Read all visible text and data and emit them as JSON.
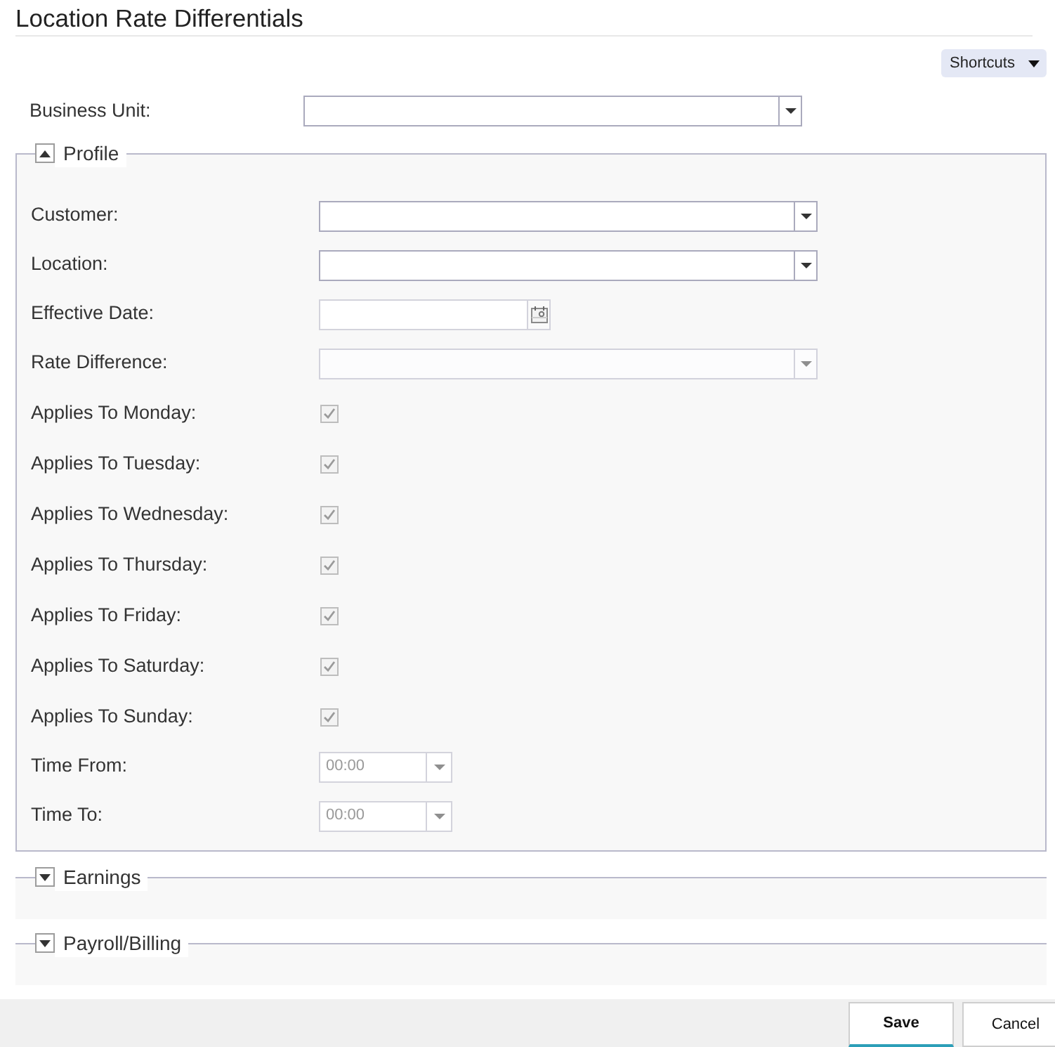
{
  "page": {
    "title": "Location Rate Differentials"
  },
  "toolbar": {
    "shortcuts_button": "Shortcuts"
  },
  "top_fields": [
    {
      "kind": "dropdown",
      "label": "Business Unit:",
      "disabled": false
    }
  ],
  "sections": [
    {
      "title": "Profile",
      "expanded": true,
      "fields": [
        {
          "kind": "dropdown",
          "label": "Customer:",
          "disabled": false
        },
        {
          "kind": "dropdown",
          "label": "Location:",
          "disabled": false
        },
        {
          "kind": "date",
          "label": "Effective Date:",
          "disabled": false
        },
        {
          "kind": "dropdown",
          "label": "Rate Difference:",
          "disabled": true
        },
        {
          "kind": "checkbox",
          "label": "Applies To Monday:",
          "checked": true,
          "disabled": true
        },
        {
          "kind": "checkbox",
          "label": "Applies To Tuesday:",
          "checked": true,
          "disabled": true
        },
        {
          "kind": "checkbox",
          "label": "Applies To Wednesday:",
          "checked": true,
          "disabled": true
        },
        {
          "kind": "checkbox",
          "label": "Applies To Thursday:",
          "checked": true,
          "disabled": true
        },
        {
          "kind": "checkbox",
          "label": "Applies To Friday:",
          "checked": true,
          "disabled": true
        },
        {
          "kind": "checkbox",
          "label": "Applies To Saturday:",
          "checked": true,
          "disabled": true
        },
        {
          "kind": "checkbox",
          "label": "Applies To Sunday:",
          "checked": true,
          "disabled": true
        },
        {
          "kind": "time",
          "label": "Time From:",
          "value": "00:00",
          "disabled": true
        },
        {
          "kind": "time",
          "label": "Time To:",
          "value": "00:00",
          "disabled": true
        }
      ]
    },
    {
      "title": "Earnings",
      "expanded": false
    },
    {
      "title": "Payroll/Billing",
      "expanded": false
    }
  ],
  "footer": {
    "buttons": [
      {
        "label": "Save",
        "kind": "primary"
      },
      {
        "label": "Cancel",
        "kind": "secondary"
      }
    ]
  }
}
